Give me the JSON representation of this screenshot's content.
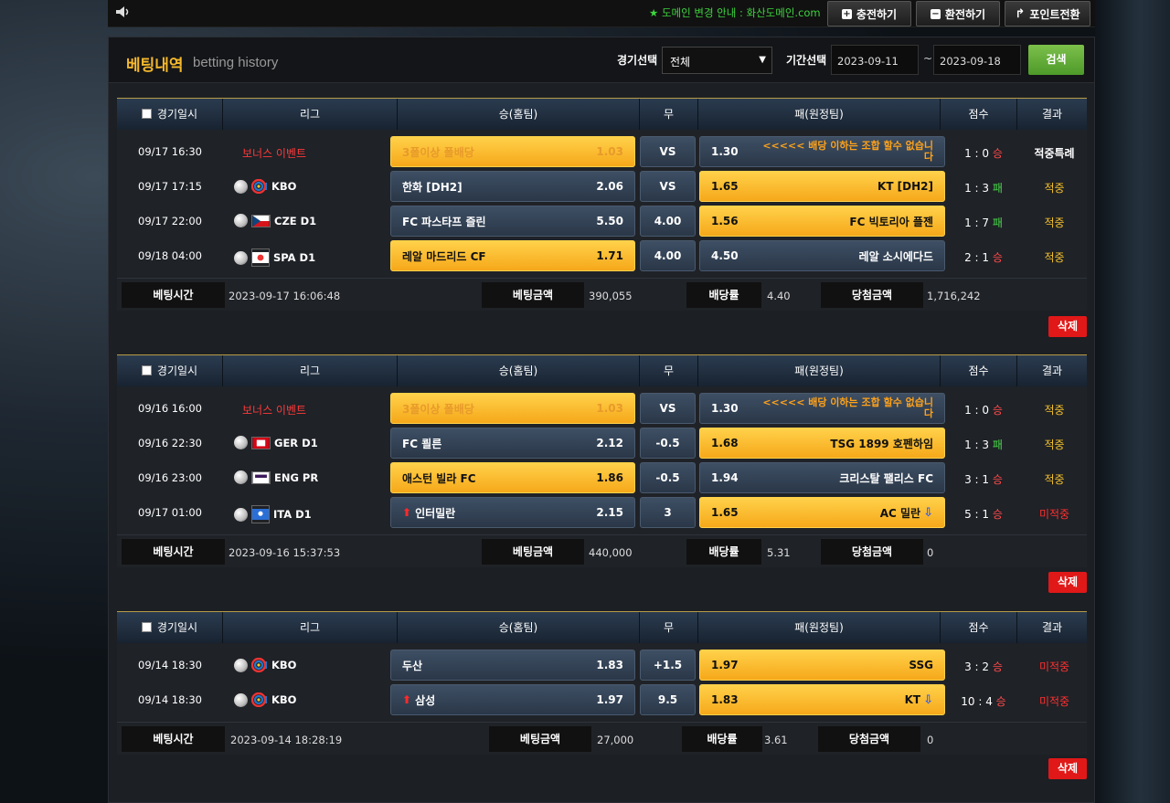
{
  "topbar": {
    "notice": "★ 도메인 변경 안내 : 화산도메인.com",
    "btn_charge": "충전하기",
    "btn_exchange": "환전하기",
    "btn_point": "포인트전환"
  },
  "header": {
    "title_ko": "베팅내역",
    "title_en": "betting history",
    "game_label": "경기선택",
    "game_value": "전체",
    "period_label": "기간선택",
    "date_from": "2023-09-11",
    "tilde": "~",
    "date_to": "2023-09-18",
    "search": "검색"
  },
  "columns": {
    "time": "경기일시",
    "league": "리그",
    "home": "승(홈팀)",
    "draw": "무",
    "away": "패(원정팀)",
    "score": "점수",
    "result": "결과"
  },
  "summary_labels": {
    "bet_time": "베팅시간",
    "bet_amount": "베팅금액",
    "odds": "배당률",
    "win_amount": "당첨금액"
  },
  "delete_label": "삭제",
  "bets": [
    {
      "rows": [
        {
          "time": "09/17 16:30",
          "bonus": "보너스 이벤트",
          "home": "3폴이상 폴배당",
          "home_odds": "1.03",
          "draw": "VS",
          "away_odds": "1.30",
          "away": "<<<<< 배당 이하는 조합 할수 없습니다",
          "score": "1 : 0",
          "score_mark": "승",
          "result": "적중특례"
        },
        {
          "time": "09/17 17:15",
          "league": "KBO",
          "home": "한화 [DH2]",
          "home_odds": "2.06",
          "draw": "VS",
          "away_odds": "1.65",
          "away": "KT [DH2]",
          "score": "1 : 3",
          "score_mark": "패",
          "result": "적중"
        },
        {
          "time": "09/17 22:00",
          "league": "CZE D1",
          "home": "FC 파스타프 즐린",
          "home_odds": "5.50",
          "draw": "4.00",
          "away_odds": "1.56",
          "away": "FC 빅토리아 플젠",
          "score": "1 : 7",
          "score_mark": "패",
          "result": "적중"
        },
        {
          "time": "09/18 04:00",
          "league": "SPA D1",
          "home": "레알 마드리드 CF",
          "home_odds": "1.71",
          "draw": "4.00",
          "away_odds": "4.50",
          "away": "레알 소시에다드",
          "score": "2 : 1",
          "score_mark": "승",
          "result": "적중"
        }
      ],
      "bet_time": "2023-09-17 16:06:48",
      "bet_amount": "390,055",
      "odds": "4.40",
      "win_amount": "1,716,242"
    },
    {
      "rows": [
        {
          "time": "09/16 16:00",
          "bonus": "보너스 이벤트",
          "home": "3폴이상 폴배당",
          "home_odds": "1.03",
          "draw": "VS",
          "away_odds": "1.30",
          "away": "<<<<< 배당 이하는 조합 할수 없습니다",
          "score": "1 : 0",
          "score_mark": "승",
          "result": "적중"
        },
        {
          "time": "09/16 22:30",
          "league": "GER D1",
          "home": "FC 쾰른",
          "home_odds": "2.12",
          "draw": "-0.5",
          "away_odds": "1.68",
          "away": "TSG 1899 호펜하임",
          "score": "1 : 3",
          "score_mark": "패",
          "result": "적중"
        },
        {
          "time": "09/16 23:00",
          "league": "ENG PR",
          "home": "애스턴 빌라 FC",
          "home_odds": "1.86",
          "draw": "-0.5",
          "away_odds": "1.94",
          "away": "크리스탈 팰리스 FC",
          "score": "3 : 1",
          "score_mark": "승",
          "result": "적중"
        },
        {
          "time": "09/17 01:00",
          "league": "ITA D1",
          "home": "인터밀란",
          "home_odds": "2.15",
          "draw": "3",
          "away_odds": "1.65",
          "away": "AC 밀란",
          "score": "5 : 1",
          "score_mark": "승",
          "result": "미적중"
        }
      ],
      "bet_time": "2023-09-16 15:37:53",
      "bet_amount": "440,000",
      "odds": "5.31",
      "win_amount": "0"
    },
    {
      "rows": [
        {
          "time": "09/14 18:30",
          "league": "KBO",
          "home": "두산",
          "home_odds": "1.83",
          "draw": "+1.5",
          "away_odds": "1.97",
          "away": "SSG",
          "score": "3 : 2",
          "score_mark": "승",
          "result": "미적중"
        },
        {
          "time": "09/14 18:30",
          "league": "KBO",
          "home": "삼성",
          "home_odds": "1.97",
          "draw": "9.5",
          "away_odds": "1.83",
          "away": "KT",
          "score": "10 : 4",
          "score_mark": "승",
          "result": "미적중"
        }
      ],
      "bet_time": "2023-09-14 18:28:19",
      "bet_amount": "27,000",
      "odds": "3.61",
      "win_amount": "0"
    }
  ]
}
